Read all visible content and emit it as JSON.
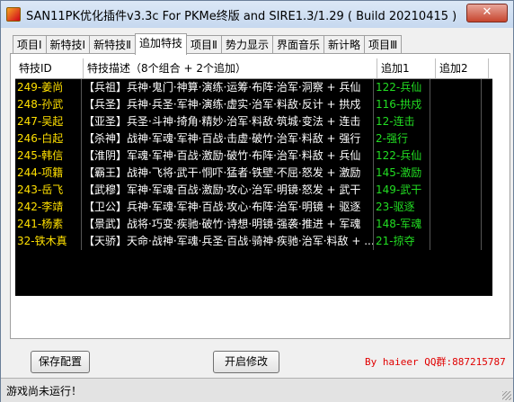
{
  "window": {
    "title": "SAN11PK优化插件v3.3c  For PKMe终版 and SIRE1.3/1.29  ( Build 20210415 )"
  },
  "tabs": [
    {
      "label": "项目Ⅰ",
      "active": false
    },
    {
      "label": "新特技Ⅰ",
      "active": false
    },
    {
      "label": "新特技Ⅱ",
      "active": false
    },
    {
      "label": "追加特技",
      "active": true
    },
    {
      "label": "项目Ⅱ",
      "active": false
    },
    {
      "label": "势力显示",
      "active": false
    },
    {
      "label": "界面音乐",
      "active": false
    },
    {
      "label": "新计略",
      "active": false
    },
    {
      "label": "项目Ⅲ",
      "active": false
    }
  ],
  "table": {
    "headers": [
      "特技ID",
      "特技描述（8个组合 + 2个追加）",
      "追加1",
      "追加2"
    ],
    "rows": [
      {
        "id": "249-姜尚",
        "desc": "【兵祖】兵神·鬼门·神算·演练·运筹·布阵·治军·洞察 + 兵仙",
        "add1": "122-兵仙",
        "add2": ""
      },
      {
        "id": "248-孙武",
        "desc": "【兵圣】兵神·兵圣·军神·演练·虚实·治军·料敌·反计 + 拱戍",
        "add1": "116-拱戍",
        "add2": ""
      },
      {
        "id": "247-吴起",
        "desc": "【亚圣】兵圣·斗神·掎角·精妙·治军·料敌·筑城·变法 + 连击",
        "add1": "12-连击",
        "add2": ""
      },
      {
        "id": "246-白起",
        "desc": "【杀神】战神·军魂·军神·百战·击虚·破竹·治军·料敌 + 强行",
        "add1": "2-强行",
        "add2": ""
      },
      {
        "id": "245-韩信",
        "desc": "【淮阴】军魂·军神·百战·激励·破竹·布阵·治军·料敌 + 兵仙",
        "add1": "122-兵仙",
        "add2": ""
      },
      {
        "id": "244-项籍",
        "desc": "【霸王】战神·飞将·武干·恫吓·猛者·铁壁·不屈·怒发 + 激励",
        "add1": "145-激励",
        "add2": ""
      },
      {
        "id": "243-岳飞",
        "desc": "【武穆】军神·军魂·百战·激励·攻心·治军·明镜·怒发 + 武干",
        "add1": "149-武干",
        "add2": ""
      },
      {
        "id": "242-李靖",
        "desc": "【卫公】兵神·军魂·军神·百战·攻心·布阵·治军·明镜 + 驱逐",
        "add1": "23-驱逐",
        "add2": ""
      },
      {
        "id": "241-杨素",
        "desc": "【景武】战将·巧变·疾驰·破竹·诗想·明镜·强袭·推进 + 军魂",
        "add1": "148-军魂",
        "add2": ""
      },
      {
        "id": "32-铁木真",
        "desc": "【天骄】天命·战神·军魂·兵圣·百战·骑神·疾驰·治军·料敌 + ...",
        "add1": "21-掠夺",
        "add2": ""
      }
    ]
  },
  "buttons": {
    "save": "保存配置",
    "start": "开启修改",
    "close": "✕"
  },
  "credit": "By haieer  QQ群:887215787",
  "status": "游戏尚未运行！",
  "colors": {
    "id_text": "#ffe000",
    "add_text": "#22dd22",
    "credit": "#e00000"
  }
}
